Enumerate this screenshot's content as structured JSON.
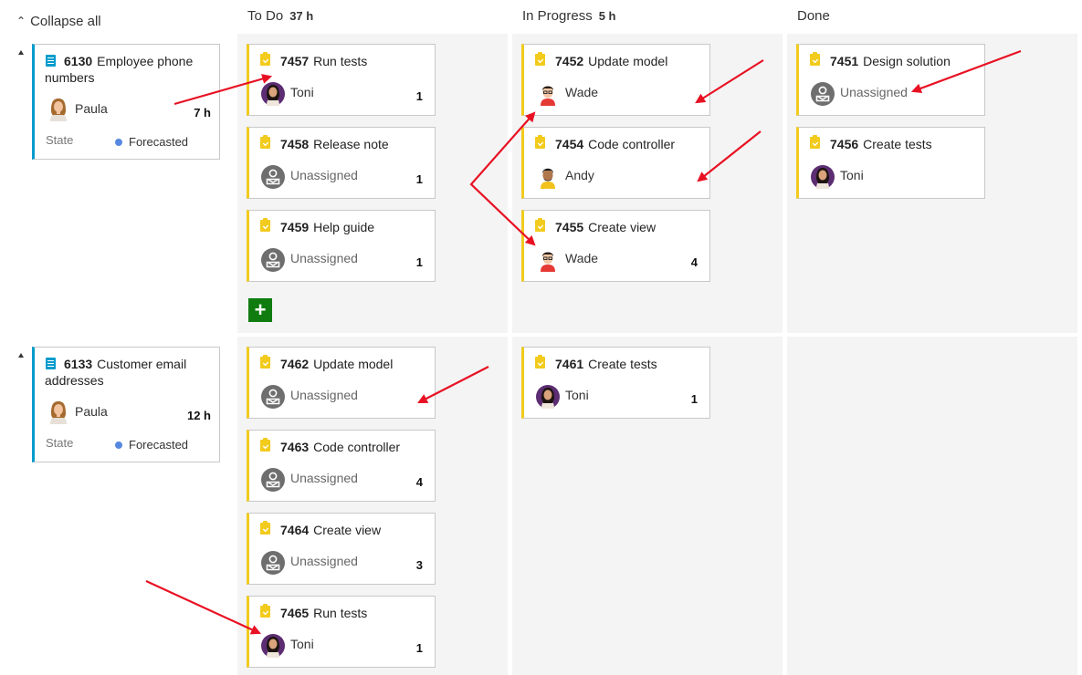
{
  "header": {
    "collapse_all_label": "Collapse all",
    "columns": [
      {
        "name": "To Do",
        "count": "37 h"
      },
      {
        "name": "In Progress",
        "count": "5 h"
      },
      {
        "name": "Done",
        "count": ""
      }
    ]
  },
  "colors": {
    "task_accent": "#f2cb1d",
    "story_accent": "#009ccc",
    "forecasted_dot": "#5688e0",
    "add_button": "#107c10",
    "lane_bg": "#f4f4f4",
    "annotation_arrow": "#e81123"
  },
  "icons": {
    "task": "clipboard-check-icon",
    "story": "document-lines-icon",
    "unassigned": "unassigned-user-icon",
    "collapse": "double-chevron-up-icon",
    "add": "plus-icon"
  },
  "rows": [
    {
      "parent": {
        "id": "6130",
        "title_line1": "Employee phone",
        "title_line2": "numbers",
        "assignee": "Paula",
        "hours": "7 h",
        "state_label": "State",
        "state": "Forecasted"
      },
      "todo": [
        {
          "id": "7457",
          "title": "Run tests",
          "assignee": "Toni",
          "remaining": "1"
        },
        {
          "id": "7458",
          "title": "Release note",
          "assignee": "Unassigned",
          "remaining": "1"
        },
        {
          "id": "7459",
          "title": "Help guide",
          "assignee": "Unassigned",
          "remaining": "1"
        }
      ],
      "in_progress": [
        {
          "id": "7452",
          "title": "Update model",
          "assignee": "Wade",
          "remaining": ""
        },
        {
          "id": "7454",
          "title": "Code controller",
          "assignee": "Andy",
          "remaining": ""
        },
        {
          "id": "7455",
          "title": "Create view",
          "assignee": "Wade",
          "remaining": "4"
        }
      ],
      "done": [
        {
          "id": "7451",
          "title": "Design solution",
          "assignee": "Unassigned",
          "remaining": ""
        },
        {
          "id": "7456",
          "title": "Create tests",
          "assignee": "Toni",
          "remaining": ""
        }
      ]
    },
    {
      "parent": {
        "id": "6133",
        "title_line1": "Customer email",
        "title_line2": "addresses",
        "assignee": "Paula",
        "hours": "12 h",
        "state_label": "State",
        "state": "Forecasted"
      },
      "todo": [
        {
          "id": "7462",
          "title": "Update model",
          "assignee": "Unassigned",
          "remaining": ""
        },
        {
          "id": "7463",
          "title": "Code controller",
          "assignee": "Unassigned",
          "remaining": "4"
        },
        {
          "id": "7464",
          "title": "Create view",
          "assignee": "Unassigned",
          "remaining": "3"
        },
        {
          "id": "7465",
          "title": "Run tests",
          "assignee": "Toni",
          "remaining": "1"
        }
      ],
      "in_progress": [
        {
          "id": "7461",
          "title": "Create tests",
          "assignee": "Toni",
          "remaining": "1"
        }
      ],
      "done": []
    }
  ]
}
